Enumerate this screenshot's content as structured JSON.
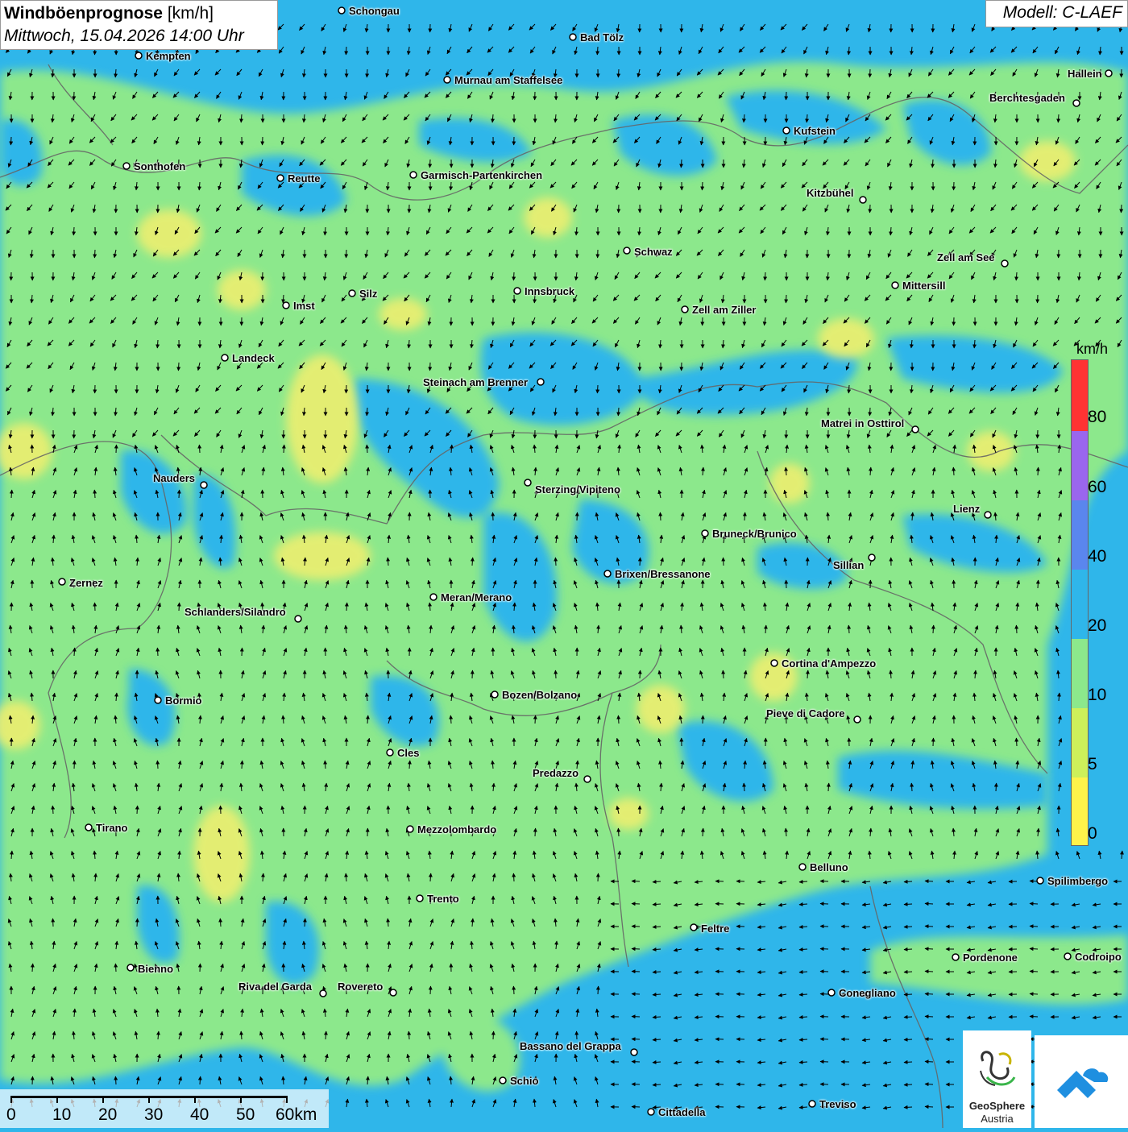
{
  "header": {
    "title_bold": "Windböenprognose",
    "title_unit": "[km/h]",
    "subtitle": "Mittwoch, 15.04.2026 14:00 Uhr",
    "model": "Modell: C-LAEF"
  },
  "legend": {
    "unit": "km/h",
    "ticks": [
      "80",
      "60",
      "40",
      "20",
      "10",
      "5",
      "0"
    ],
    "colors": [
      "#ff3333",
      "#9a66ee",
      "#5a86ee",
      "#2fb6ea",
      "#8ce88c",
      "#cdf05a",
      "#fff34a"
    ]
  },
  "scale_bar": {
    "labels": [
      "0",
      "10",
      "20",
      "30",
      "40",
      "50",
      "60km"
    ]
  },
  "logos": {
    "geosphere_line1": "GeoSphere",
    "geosphere_line2": "Austria",
    "geosphere_icon": "geosphere-logo-icon",
    "app_icon": "cloud-app-icon"
  },
  "map_colors": {
    "water_blue": "#2fb6ea",
    "green": "#8ce88c",
    "yellow": "#f3ef6e",
    "border": "#666666"
  },
  "cities": [
    {
      "name": "Schongau"
    },
    {
      "name": "Bad Tölz"
    },
    {
      "name": "Kempten"
    },
    {
      "name": "Hallein"
    },
    {
      "name": "Murnau am Staffelsee"
    },
    {
      "name": "Berchtesgaden"
    },
    {
      "name": "Kufstein"
    },
    {
      "name": "Sonthofen"
    },
    {
      "name": "Reutte"
    },
    {
      "name": "Garmisch-Partenkirchen"
    },
    {
      "name": "Kitzbühel"
    },
    {
      "name": "Schwaz"
    },
    {
      "name": "Zell am See"
    },
    {
      "name": "Mittersill"
    },
    {
      "name": "Innsbruck"
    },
    {
      "name": "Silz"
    },
    {
      "name": "Imst"
    },
    {
      "name": "Zell am Ziller"
    },
    {
      "name": "Landeck"
    },
    {
      "name": "Steinach am Brenner"
    },
    {
      "name": "Matrei in Osttirol"
    },
    {
      "name": "Nauders"
    },
    {
      "name": "Sterzing/Vipiteno"
    },
    {
      "name": "Lienz"
    },
    {
      "name": "Bruneck/Brunico"
    },
    {
      "name": "Sillian"
    },
    {
      "name": "Brixen/Bressanone"
    },
    {
      "name": "Zernez"
    },
    {
      "name": "Meran/Merano"
    },
    {
      "name": "Schlanders/Silandro"
    },
    {
      "name": "Cortina d'Ampezzo"
    },
    {
      "name": "Bozen/Bolzano"
    },
    {
      "name": "Bormio"
    },
    {
      "name": "Pieve di Cadore"
    },
    {
      "name": "Cles"
    },
    {
      "name": "Predazzo"
    },
    {
      "name": "Tirano"
    },
    {
      "name": "Mezzolombardo"
    },
    {
      "name": "Belluno"
    },
    {
      "name": "Spilimbergo"
    },
    {
      "name": "Trento"
    },
    {
      "name": "Feltre"
    },
    {
      "name": "Pordenone"
    },
    {
      "name": "Codroipo"
    },
    {
      "name": "Bienno"
    },
    {
      "name": "Riva del Garda"
    },
    {
      "name": "Rovereto"
    },
    {
      "name": "Conegliano"
    },
    {
      "name": "Bassano del Grappa"
    },
    {
      "name": "Schio"
    },
    {
      "name": "Treviso"
    },
    {
      "name": "Cittadella"
    }
  ]
}
